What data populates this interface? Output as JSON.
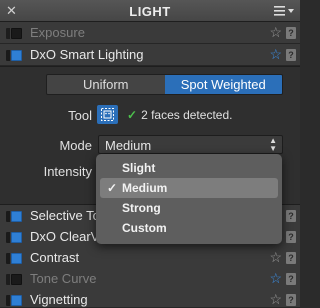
{
  "header": {
    "title": "LIGHT",
    "close_icon": "close-icon",
    "menu_icon": "panel-menu-icon"
  },
  "rows_top": [
    {
      "label": "Exposure",
      "enabled": false,
      "dim": true,
      "star": "gray"
    },
    {
      "label": "DxO Smart Lighting",
      "enabled": true,
      "dim": false,
      "star": "blue"
    }
  ],
  "smart_lighting": {
    "mode_tabs": [
      "Uniform",
      "Spot Weighted"
    ],
    "active_tab": "Spot Weighted",
    "tool_label": "Tool",
    "faces_status": "2 faces detected.",
    "mode_label": "Mode",
    "mode_value": "Medium",
    "intensity_label": "Intensity",
    "mode_options": [
      "Slight",
      "Medium",
      "Strong",
      "Custom"
    ],
    "selected_option": "Medium",
    "check_mark": "✓"
  },
  "rows_bottom": [
    {
      "label": "Selective Tone",
      "enabled": true,
      "dim": false,
      "star": "gray"
    },
    {
      "label": "DxO ClearView",
      "enabled": true,
      "dim": false,
      "star": "gray"
    },
    {
      "label": "Contrast",
      "enabled": true,
      "dim": false,
      "star": "gray"
    },
    {
      "label": "Tone Curve",
      "enabled": false,
      "dim": true,
      "star": "blue"
    },
    {
      "label": "Vignetting",
      "enabled": true,
      "dim": false,
      "star": "gray"
    }
  ],
  "help_glyph": "?",
  "star_glyph": "☆",
  "colors": {
    "accent_blue": "#2b6fb9",
    "check_green": "#4cc04c",
    "panel_bg": "#2b2b2b"
  }
}
